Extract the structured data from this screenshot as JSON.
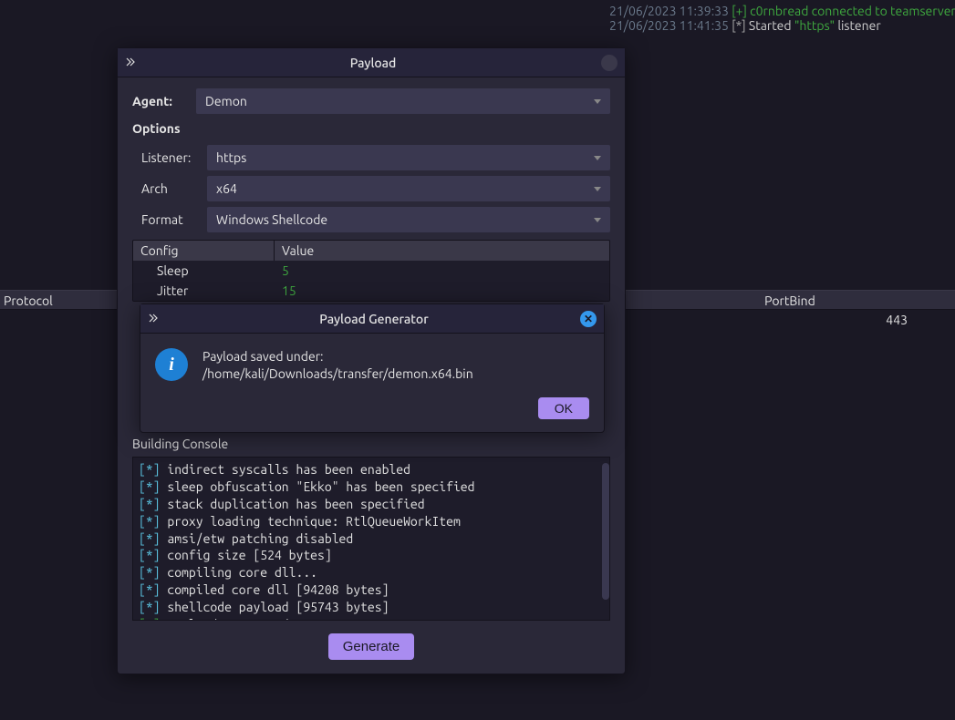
{
  "log": [
    {
      "ts": "21/06/2023 11:39:33",
      "marker": "[+]",
      "marker_class": "plus",
      "parts": [
        {
          "text": "c0rnbread connected to teamserver",
          "class": "green-user"
        }
      ]
    },
    {
      "ts": "21/06/2023 11:41:35",
      "marker": "[*]",
      "marker_class": "star",
      "parts": [
        {
          "text": "Started ",
          "class": "teal-msg"
        },
        {
          "text": "\"https\"",
          "class": "quoted"
        },
        {
          "text": " listener",
          "class": "teal-msg"
        }
      ]
    }
  ],
  "table": {
    "protocol_header": "Protocol",
    "portbind_header": "PortBind",
    "portbind_value": "443"
  },
  "payload_dialog": {
    "title": "Payload",
    "agent_label": "Agent:",
    "agent_value": "Demon",
    "options_heading": "Options",
    "listener_label": "Listener:",
    "listener_value": "https",
    "arch_label": "Arch",
    "arch_value": "x64",
    "format_label": "Format",
    "format_value": "Windows Shellcode",
    "config_header": "Config",
    "value_header": "Value",
    "config_rows": [
      {
        "name": "Sleep",
        "value": "5"
      },
      {
        "name": "Jitter",
        "value": "15"
      }
    ],
    "building_heading": "Building Console",
    "console_lines": [
      {
        "marker": "[*]",
        "class": "cstar",
        "text": "indirect syscalls has been enabled"
      },
      {
        "marker": "[*]",
        "class": "cstar",
        "text": "sleep obfuscation \"Ekko\" has been specified"
      },
      {
        "marker": "[*]",
        "class": "cstar",
        "text": "stack duplication has been specified"
      },
      {
        "marker": "[*]",
        "class": "cstar",
        "text": "proxy loading technique: RtlQueueWorkItem"
      },
      {
        "marker": "[*]",
        "class": "cstar",
        "text": "amsi/etw patching disabled"
      },
      {
        "marker": "[*]",
        "class": "cstar",
        "text": "config size [524 bytes]"
      },
      {
        "marker": "[*]",
        "class": "cstar",
        "text": "compiling core dll..."
      },
      {
        "marker": "[*]",
        "class": "cstar",
        "text": "compiled core dll [94208 bytes]"
      },
      {
        "marker": "[*]",
        "class": "cstar",
        "text": "shellcode payload [95743 bytes]"
      },
      {
        "marker": "[+]",
        "class": "cplus",
        "text": "payload generated"
      }
    ],
    "generate_label": "Generate"
  },
  "msg_dialog": {
    "title": "Payload Generator",
    "message": "Payload saved under: /home/kali/Downloads/transfer/demon.x64.bin",
    "ok_label": "OK"
  }
}
